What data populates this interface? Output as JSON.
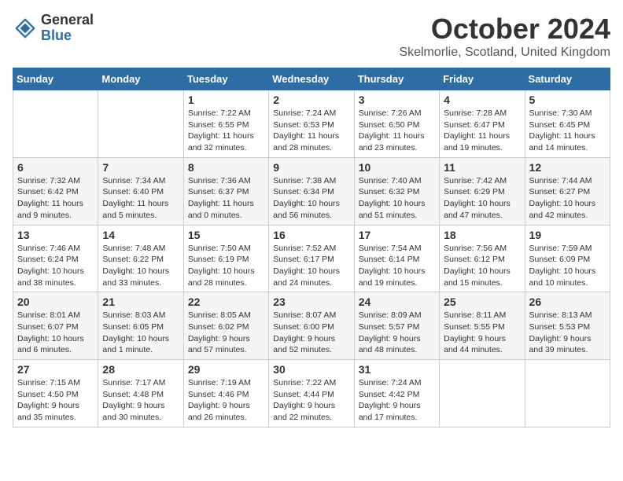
{
  "header": {
    "logo_line1": "General",
    "logo_line2": "Blue",
    "month_title": "October 2024",
    "location": "Skelmorlie, Scotland, United Kingdom"
  },
  "weekdays": [
    "Sunday",
    "Monday",
    "Tuesday",
    "Wednesday",
    "Thursday",
    "Friday",
    "Saturday"
  ],
  "weeks": [
    [
      {
        "day": "",
        "info": ""
      },
      {
        "day": "",
        "info": ""
      },
      {
        "day": "1",
        "info": "Sunrise: 7:22 AM\nSunset: 6:55 PM\nDaylight: 11 hours\nand 32 minutes."
      },
      {
        "day": "2",
        "info": "Sunrise: 7:24 AM\nSunset: 6:53 PM\nDaylight: 11 hours\nand 28 minutes."
      },
      {
        "day": "3",
        "info": "Sunrise: 7:26 AM\nSunset: 6:50 PM\nDaylight: 11 hours\nand 23 minutes."
      },
      {
        "day": "4",
        "info": "Sunrise: 7:28 AM\nSunset: 6:47 PM\nDaylight: 11 hours\nand 19 minutes."
      },
      {
        "day": "5",
        "info": "Sunrise: 7:30 AM\nSunset: 6:45 PM\nDaylight: 11 hours\nand 14 minutes."
      }
    ],
    [
      {
        "day": "6",
        "info": "Sunrise: 7:32 AM\nSunset: 6:42 PM\nDaylight: 11 hours\nand 9 minutes."
      },
      {
        "day": "7",
        "info": "Sunrise: 7:34 AM\nSunset: 6:40 PM\nDaylight: 11 hours\nand 5 minutes."
      },
      {
        "day": "8",
        "info": "Sunrise: 7:36 AM\nSunset: 6:37 PM\nDaylight: 11 hours\nand 0 minutes."
      },
      {
        "day": "9",
        "info": "Sunrise: 7:38 AM\nSunset: 6:34 PM\nDaylight: 10 hours\nand 56 minutes."
      },
      {
        "day": "10",
        "info": "Sunrise: 7:40 AM\nSunset: 6:32 PM\nDaylight: 10 hours\nand 51 minutes."
      },
      {
        "day": "11",
        "info": "Sunrise: 7:42 AM\nSunset: 6:29 PM\nDaylight: 10 hours\nand 47 minutes."
      },
      {
        "day": "12",
        "info": "Sunrise: 7:44 AM\nSunset: 6:27 PM\nDaylight: 10 hours\nand 42 minutes."
      }
    ],
    [
      {
        "day": "13",
        "info": "Sunrise: 7:46 AM\nSunset: 6:24 PM\nDaylight: 10 hours\nand 38 minutes."
      },
      {
        "day": "14",
        "info": "Sunrise: 7:48 AM\nSunset: 6:22 PM\nDaylight: 10 hours\nand 33 minutes."
      },
      {
        "day": "15",
        "info": "Sunrise: 7:50 AM\nSunset: 6:19 PM\nDaylight: 10 hours\nand 28 minutes."
      },
      {
        "day": "16",
        "info": "Sunrise: 7:52 AM\nSunset: 6:17 PM\nDaylight: 10 hours\nand 24 minutes."
      },
      {
        "day": "17",
        "info": "Sunrise: 7:54 AM\nSunset: 6:14 PM\nDaylight: 10 hours\nand 19 minutes."
      },
      {
        "day": "18",
        "info": "Sunrise: 7:56 AM\nSunset: 6:12 PM\nDaylight: 10 hours\nand 15 minutes."
      },
      {
        "day": "19",
        "info": "Sunrise: 7:59 AM\nSunset: 6:09 PM\nDaylight: 10 hours\nand 10 minutes."
      }
    ],
    [
      {
        "day": "20",
        "info": "Sunrise: 8:01 AM\nSunset: 6:07 PM\nDaylight: 10 hours\nand 6 minutes."
      },
      {
        "day": "21",
        "info": "Sunrise: 8:03 AM\nSunset: 6:05 PM\nDaylight: 10 hours\nand 1 minute."
      },
      {
        "day": "22",
        "info": "Sunrise: 8:05 AM\nSunset: 6:02 PM\nDaylight: 9 hours\nand 57 minutes."
      },
      {
        "day": "23",
        "info": "Sunrise: 8:07 AM\nSunset: 6:00 PM\nDaylight: 9 hours\nand 52 minutes."
      },
      {
        "day": "24",
        "info": "Sunrise: 8:09 AM\nSunset: 5:57 PM\nDaylight: 9 hours\nand 48 minutes."
      },
      {
        "day": "25",
        "info": "Sunrise: 8:11 AM\nSunset: 5:55 PM\nDaylight: 9 hours\nand 44 minutes."
      },
      {
        "day": "26",
        "info": "Sunrise: 8:13 AM\nSunset: 5:53 PM\nDaylight: 9 hours\nand 39 minutes."
      }
    ],
    [
      {
        "day": "27",
        "info": "Sunrise: 7:15 AM\nSunset: 4:50 PM\nDaylight: 9 hours\nand 35 minutes."
      },
      {
        "day": "28",
        "info": "Sunrise: 7:17 AM\nSunset: 4:48 PM\nDaylight: 9 hours\nand 30 minutes."
      },
      {
        "day": "29",
        "info": "Sunrise: 7:19 AM\nSunset: 4:46 PM\nDaylight: 9 hours\nand 26 minutes."
      },
      {
        "day": "30",
        "info": "Sunrise: 7:22 AM\nSunset: 4:44 PM\nDaylight: 9 hours\nand 22 minutes."
      },
      {
        "day": "31",
        "info": "Sunrise: 7:24 AM\nSunset: 4:42 PM\nDaylight: 9 hours\nand 17 minutes."
      },
      {
        "day": "",
        "info": ""
      },
      {
        "day": "",
        "info": ""
      }
    ]
  ]
}
